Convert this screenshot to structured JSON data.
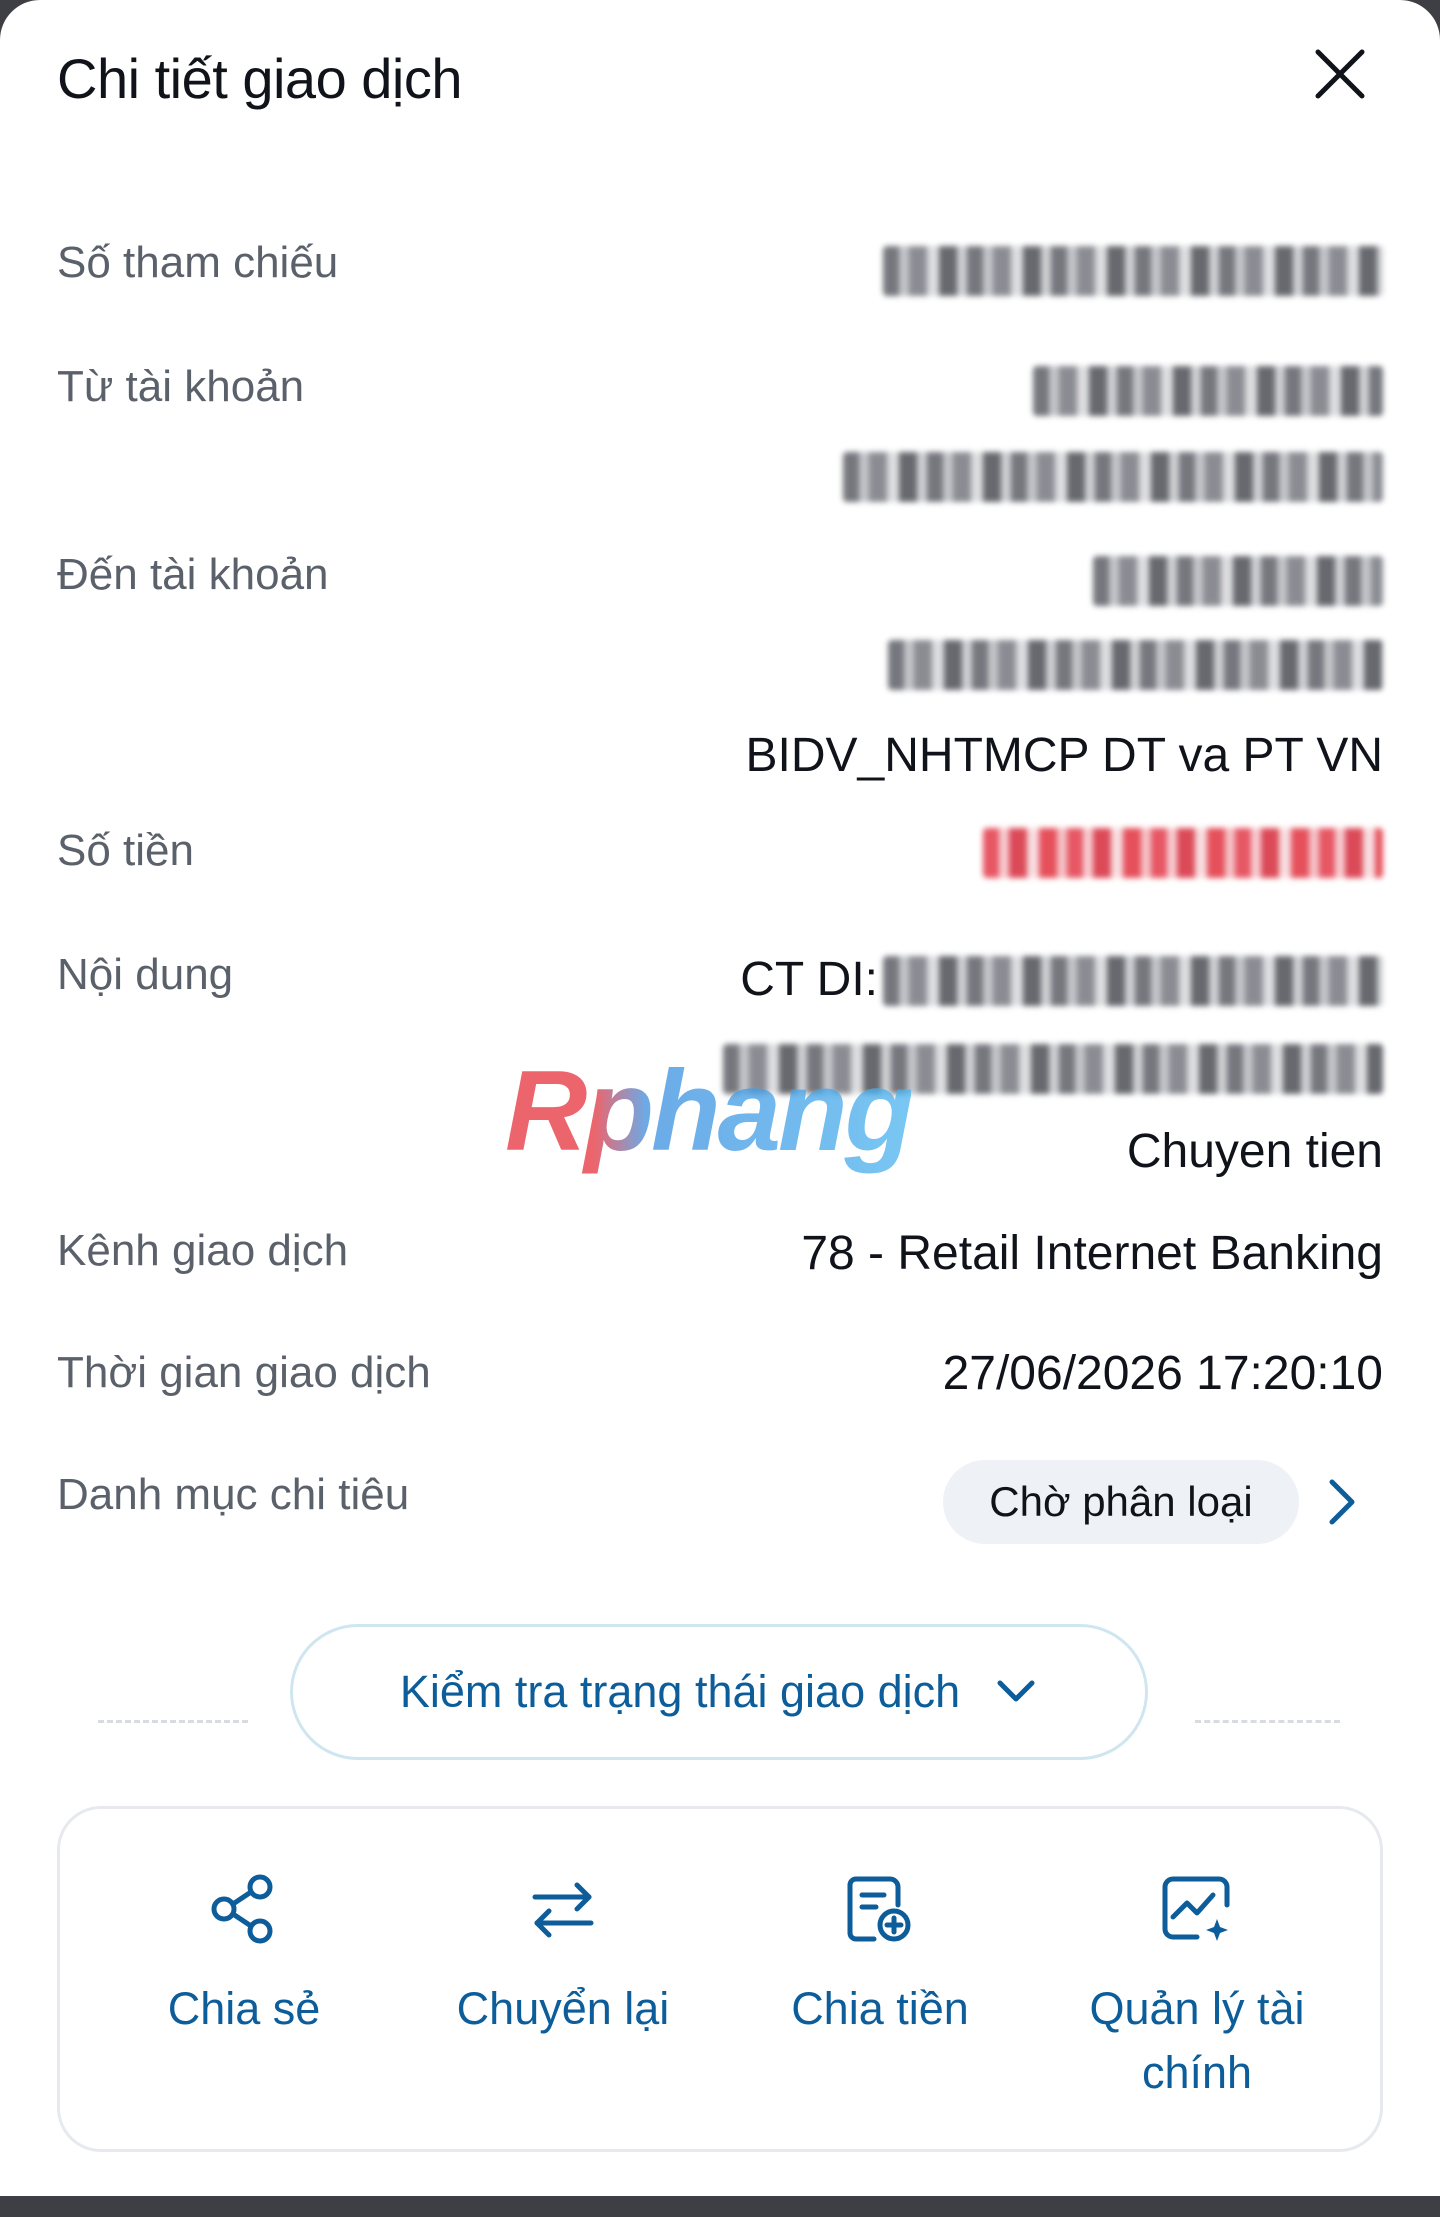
{
  "header": {
    "title": "Chi tiết giao dịch"
  },
  "rows": {
    "reference": {
      "label": "Số tham chiếu"
    },
    "from_account": {
      "label": "Từ tài khoản"
    },
    "to_account": {
      "label": "Đến tài khoản",
      "bank": "BIDV_NHTMCP DT va PT VN"
    },
    "amount": {
      "label": "Số tiền"
    },
    "content": {
      "label": "Nội dung",
      "line1_prefix": "CT DI:",
      "line3": "Chuyen tien"
    },
    "channel": {
      "label": "Kênh giao dịch",
      "value": "78 - Retail Internet Banking"
    },
    "time": {
      "label": "Thời gian giao dịch",
      "value": "27/06/2026 17:20:10"
    },
    "category": {
      "label": "Danh mục chi tiêu",
      "value": "Chờ phân loại"
    }
  },
  "status_check": {
    "label": "Kiểm tra trạng thái giao dịch"
  },
  "actions": [
    {
      "label": "Chia sẻ",
      "icon": "share-icon"
    },
    {
      "label": "Chuyển lại",
      "icon": "transfer-arrows-icon"
    },
    {
      "label": "Chia tiền",
      "icon": "split-bill-icon"
    },
    {
      "label": "Quản lý tài chính",
      "icon": "finance-chart-icon"
    }
  ],
  "watermark": "Rphang",
  "colors": {
    "accent": "#0c5d9a",
    "label": "#5b616b",
    "text": "#10131a",
    "amount": "#e33a4a"
  }
}
